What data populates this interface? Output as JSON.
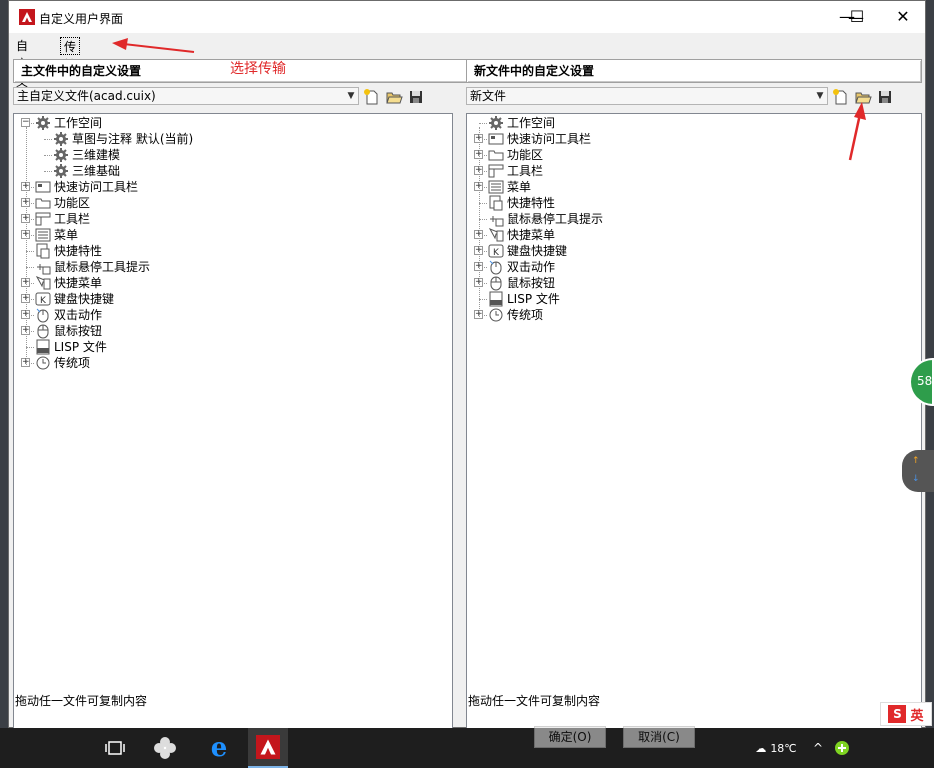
{
  "window": {
    "title": "自定义用户界面",
    "minimize": "—",
    "maximize": "☐",
    "close": "✕"
  },
  "tabs": [
    {
      "label": "自定义"
    },
    {
      "label": "传输"
    }
  ],
  "annotation": {
    "text": "选择传输"
  },
  "left": {
    "header": "主文件中的自定义设置",
    "file_select": "主自定义文件(acad.cuix)",
    "status": "拖动任一文件可复制内容",
    "tree": [
      {
        "label": "工作空间",
        "icon": "gear-icon",
        "level": 0,
        "expander": "minus"
      },
      {
        "label": "草图与注释 默认(当前)",
        "icon": "gear-icon",
        "level": 1,
        "expander": "none"
      },
      {
        "label": "三维建模",
        "icon": "gear-icon",
        "level": 1,
        "expander": "none"
      },
      {
        "label": "三维基础",
        "icon": "gear-icon",
        "level": 1,
        "expander": "none"
      },
      {
        "label": "快速访问工具栏",
        "icon": "toolbar-icon",
        "level": 0,
        "expander": "plus"
      },
      {
        "label": "功能区",
        "icon": "folder-icon",
        "level": 0,
        "expander": "plus"
      },
      {
        "label": "工具栏",
        "icon": "toolbars-icon",
        "level": 0,
        "expander": "plus"
      },
      {
        "label": "菜单",
        "icon": "menu-icon",
        "level": 0,
        "expander": "plus"
      },
      {
        "label": "快捷特性",
        "icon": "properties-icon",
        "level": 0,
        "expander": "none"
      },
      {
        "label": "鼠标悬停工具提示",
        "icon": "tooltip-icon",
        "level": 0,
        "expander": "none"
      },
      {
        "label": "快捷菜单",
        "icon": "shortcut-menu-icon",
        "level": 0,
        "expander": "plus"
      },
      {
        "label": "键盘快捷键",
        "icon": "keyboard-icon",
        "level": 0,
        "expander": "plus"
      },
      {
        "label": "双击动作",
        "icon": "double-click-icon",
        "level": 0,
        "expander": "plus"
      },
      {
        "label": "鼠标按钮",
        "icon": "mouse-icon",
        "level": 0,
        "expander": "plus"
      },
      {
        "label": "LISP 文件",
        "icon": "lisp-icon",
        "level": 0,
        "expander": "none"
      },
      {
        "label": "传统项",
        "icon": "legacy-icon",
        "level": 0,
        "expander": "plus"
      }
    ]
  },
  "right": {
    "header": "新文件中的自定义设置",
    "file_select": "新文件",
    "status": "拖动任一文件可复制内容",
    "tree": [
      {
        "label": "工作空间",
        "icon": "gear-icon",
        "level": 0,
        "expander": "none"
      },
      {
        "label": "快速访问工具栏",
        "icon": "toolbar-icon",
        "level": 0,
        "expander": "plus"
      },
      {
        "label": "功能区",
        "icon": "folder-icon",
        "level": 0,
        "expander": "plus"
      },
      {
        "label": "工具栏",
        "icon": "toolbars-icon",
        "level": 0,
        "expander": "plus"
      },
      {
        "label": "菜单",
        "icon": "menu-icon",
        "level": 0,
        "expander": "plus"
      },
      {
        "label": "快捷特性",
        "icon": "properties-icon",
        "level": 0,
        "expander": "none"
      },
      {
        "label": "鼠标悬停工具提示",
        "icon": "tooltip-icon",
        "level": 0,
        "expander": "none"
      },
      {
        "label": "快捷菜单",
        "icon": "shortcut-menu-icon",
        "level": 0,
        "expander": "plus"
      },
      {
        "label": "键盘快捷键",
        "icon": "keyboard-icon",
        "level": 0,
        "expander": "plus"
      },
      {
        "label": "双击动作",
        "icon": "double-click-icon",
        "level": 0,
        "expander": "plus"
      },
      {
        "label": "鼠标按钮",
        "icon": "mouse-icon",
        "level": 0,
        "expander": "plus"
      },
      {
        "label": "LISP 文件",
        "icon": "lisp-icon",
        "level": 0,
        "expander": "none"
      },
      {
        "label": "传统项",
        "icon": "legacy-icon",
        "level": 0,
        "expander": "plus"
      }
    ]
  },
  "buttons": {
    "ok": "确定(O)",
    "cancel": "取消(C)"
  },
  "taskbar": {
    "temperature": "18℃",
    "ime": "英",
    "badge": "58"
  },
  "colors": {
    "accent": "#c4161c",
    "annotation": "#e0292a",
    "taskbar": "#1e1e1e"
  }
}
